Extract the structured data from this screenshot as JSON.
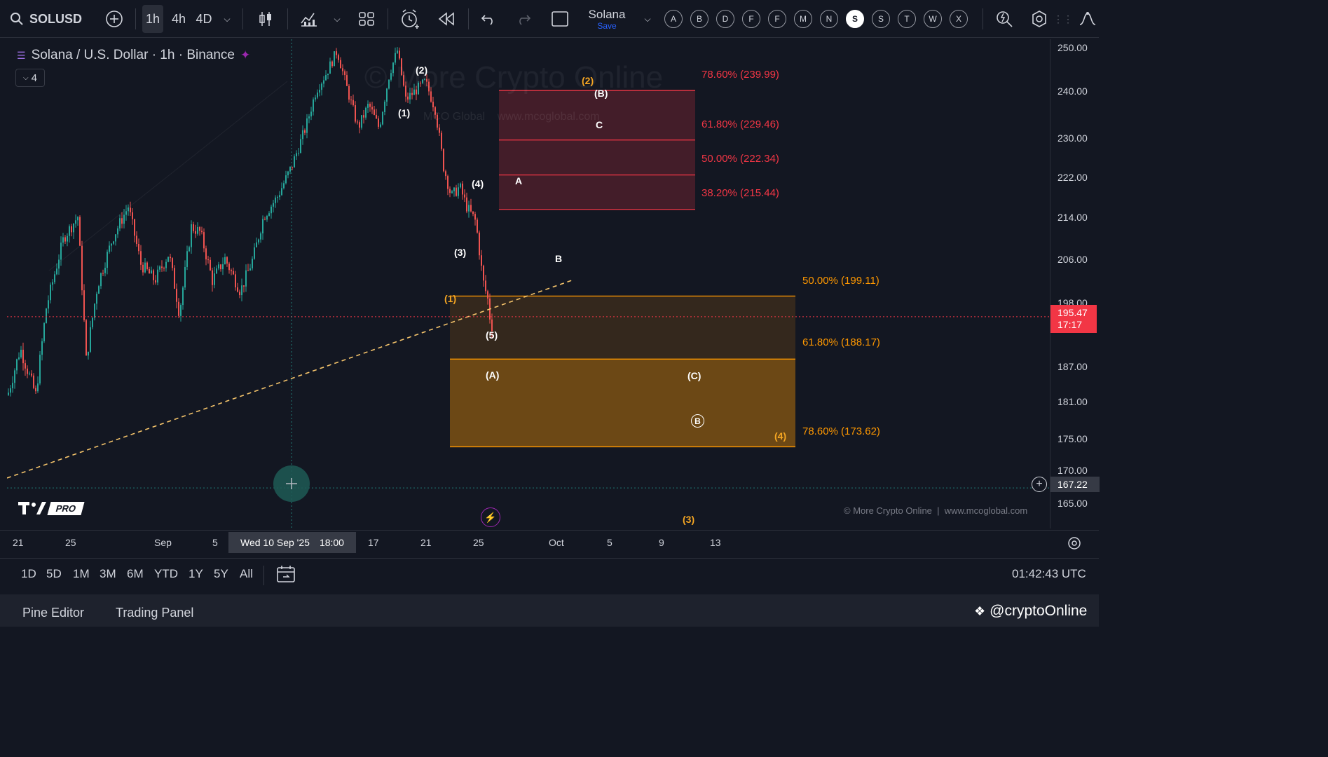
{
  "toolbar": {
    "symbol": "SOLUSD",
    "intervals": [
      "1h",
      "4h",
      "4D"
    ],
    "active_interval": "1h",
    "layout_name": "Solana",
    "layout_save": "Save",
    "letter_buttons": [
      "A",
      "B",
      "D",
      "F",
      "F",
      "M",
      "N",
      "S",
      "S",
      "T",
      "W",
      "X"
    ],
    "active_letter_index": 7
  },
  "legend": {
    "title": "Solana / U.S. Dollar · 1h · Binance",
    "collapse_count": "4"
  },
  "watermark": {
    "brand": "© More Crypto Online",
    "sub": "MCO Global    www.mcoglobal.com",
    "copyright": "© More Crypto Online  |  www.mcoglobal.com",
    "tv_pro": "PRO"
  },
  "price_axis": {
    "labels": [
      "250.00",
      "240.00",
      "230.00",
      "222.00",
      "214.00",
      "206.00",
      "198.00",
      "187.00",
      "181.00",
      "175.00",
      "170.00",
      "165.00"
    ],
    "current_price": "195.47",
    "countdown": "17:17",
    "crosshair_price": "167.22"
  },
  "time_axis": {
    "labels": [
      "21",
      "25",
      "Sep",
      "5",
      "17",
      "21",
      "25",
      "Oct",
      "5",
      "9",
      "13"
    ],
    "crosshair_label": "Wed 10 Sep '25",
    "crosshair_time": "18:00"
  },
  "fib_upper": [
    {
      "label": "78.60% (239.99)",
      "price": 239.99
    },
    {
      "label": "61.80% (229.46)",
      "price": 229.46
    },
    {
      "label": "50.00% (222.34)",
      "price": 222.34
    },
    {
      "label": "38.20% (215.44)",
      "price": 215.44
    }
  ],
  "fib_lower": [
    {
      "label": "50.00% (199.11)",
      "price": 199.11
    },
    {
      "label": "61.80% (188.17)",
      "price": 188.17
    },
    {
      "label": "78.60% (173.62)",
      "price": 173.62
    }
  ],
  "wave_labels": {
    "w1": "(1)",
    "w2": "(2)",
    "w3": "(3)",
    "w4": "(4)",
    "w5": "(5)",
    "A": "A",
    "B": "B",
    "C": "C",
    "Bp": "(B)",
    "Ap": "(A)",
    "Cp": "(C)",
    "Bc": "B",
    "o1": "(1)",
    "o2": "(2)",
    "o3": "(3)",
    "o4": "(4)"
  },
  "range_bar": {
    "ranges": [
      "1D",
      "5D",
      "1M",
      "3M",
      "6M",
      "YTD",
      "1Y",
      "5Y",
      "All"
    ],
    "clock": "01:42:43 UTC"
  },
  "bottom": {
    "pine_editor": "Pine Editor",
    "trading_panel": "Trading Panel",
    "handle": "@cryptoOnline"
  },
  "colors": {
    "bg": "#131722",
    "up": "#26a69a",
    "down": "#ef5350",
    "fib_red": "#f23645",
    "fib_orange": "#ff9800"
  }
}
